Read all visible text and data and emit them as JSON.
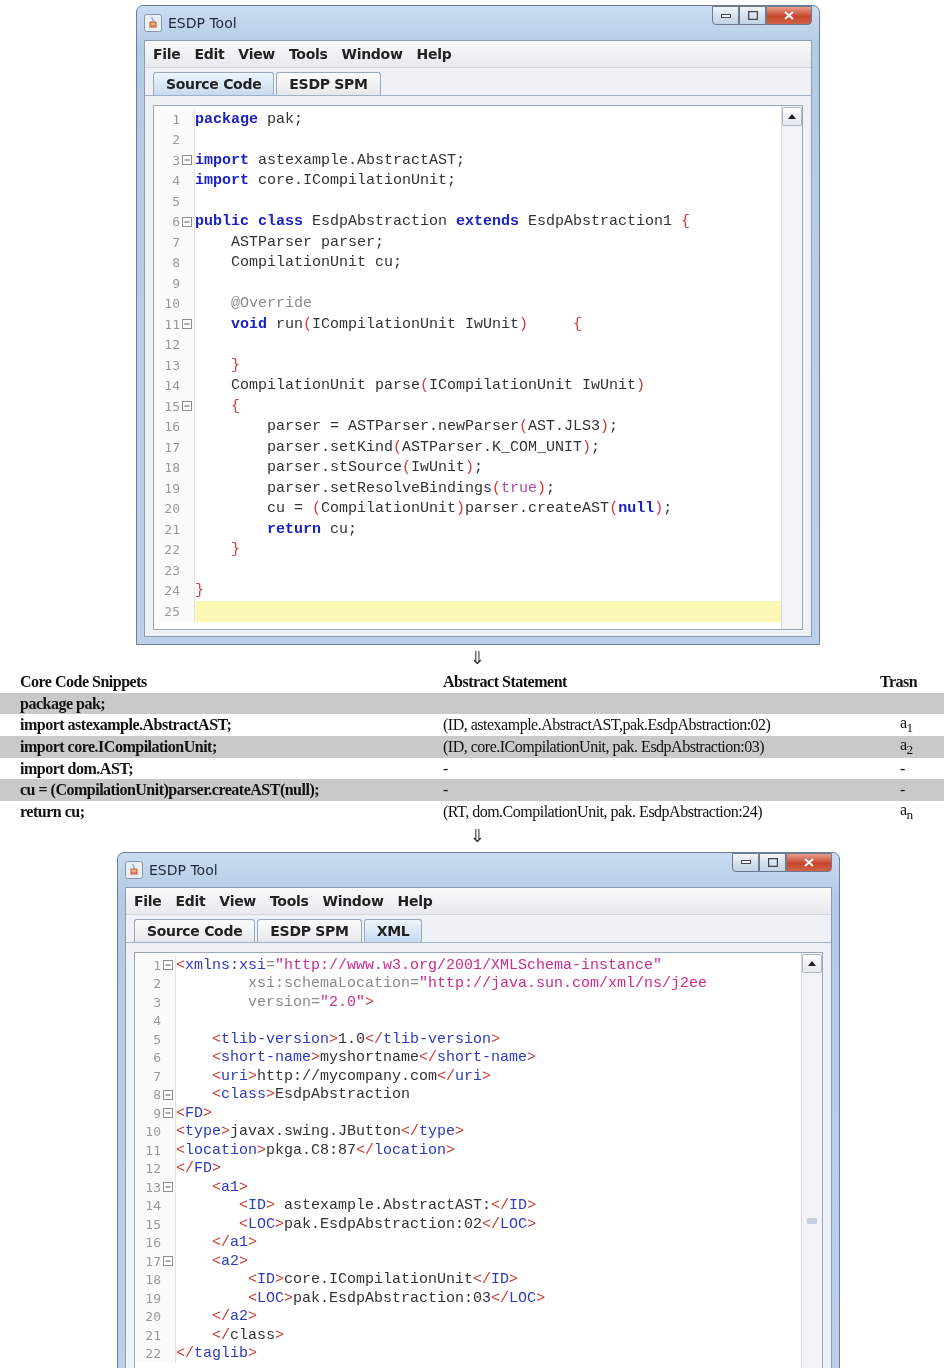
{
  "windows": [
    {
      "title": "ESDP Tool",
      "menu": [
        "File",
        "Edit",
        "View",
        "Tools",
        "Window",
        "Help"
      ],
      "tabs": [
        {
          "label": "Source Code",
          "selected": true
        },
        {
          "label": "ESDP SPM",
          "selected": false
        }
      ],
      "lines": [
        {
          "number": "1",
          "fold": false,
          "highlighted": false,
          "tokens": [
            {
              "kind": "kw",
              "text": "package"
            },
            {
              "kind": "id",
              "text": " pak;"
            }
          ]
        },
        {
          "number": "2",
          "fold": false,
          "highlighted": false
        },
        {
          "number": "3",
          "fold": true,
          "highlighted": false,
          "tokens": [
            {
              "kind": "kw",
              "text": "import"
            },
            {
              "kind": "id",
              "text": " astexample.AbstractAST;"
            }
          ]
        },
        {
          "number": "4",
          "fold": false,
          "highlighted": false,
          "tokens": [
            {
              "kind": "kw",
              "text": "import"
            },
            {
              "kind": "id",
              "text": " core.ICompilationUnit;"
            }
          ]
        },
        {
          "number": "5",
          "fold": false,
          "highlighted": false
        },
        {
          "number": "6",
          "fold": true,
          "highlighted": false,
          "tokens": [
            {
              "kind": "kw",
              "text": "public class"
            },
            {
              "kind": "id",
              "text": " EsdpAbstraction "
            },
            {
              "kind": "kw",
              "text": "extends"
            },
            {
              "kind": "id",
              "text": " EsdpAbstraction1 "
            },
            {
              "kind": "br",
              "text": "{"
            }
          ]
        },
        {
          "number": "7",
          "fold": false,
          "highlighted": false,
          "tokens": [
            {
              "kind": "id",
              "text": "    ASTParser parser;"
            }
          ]
        },
        {
          "number": "8",
          "fold": false,
          "highlighted": false,
          "tokens": [
            {
              "kind": "id",
              "text": "    CompilationUnit cu;"
            }
          ]
        },
        {
          "number": "9",
          "fold": false,
          "highlighted": false
        },
        {
          "number": "10",
          "fold": false,
          "highlighted": false,
          "tokens": [
            {
              "kind": "ann",
              "text": "    @Override"
            }
          ]
        },
        {
          "number": "11",
          "fold": true,
          "highlighted": false,
          "tokens": [
            {
              "kind": "kw",
              "text": "    void"
            },
            {
              "kind": "id",
              "text": " run"
            },
            {
              "kind": "br",
              "text": "("
            },
            {
              "kind": "id",
              "text": "ICompilationUnit IwUnit"
            },
            {
              "kind": "br",
              "text": ")"
            },
            {
              "kind": "br",
              "text": "     {"
            }
          ]
        },
        {
          "number": "12",
          "fold": false,
          "highlighted": false
        },
        {
          "number": "13",
          "fold": false,
          "highlighted": false,
          "tokens": [
            {
              "kind": "br",
              "text": "    }"
            }
          ]
        },
        {
          "number": "14",
          "fold": false,
          "highlighted": false,
          "tokens": [
            {
              "kind": "id",
              "text": "    CompilationUnit parse"
            },
            {
              "kind": "br",
              "text": "("
            },
            {
              "kind": "id",
              "text": "ICompilationUnit IwUnit"
            },
            {
              "kind": "br",
              "text": ")"
            }
          ]
        },
        {
          "number": "15",
          "fold": true,
          "highlighted": false,
          "tokens": [
            {
              "kind": "br",
              "text": "    {"
            }
          ]
        },
        {
          "number": "16",
          "fold": false,
          "highlighted": false,
          "tokens": [
            {
              "kind": "id",
              "text": "        parser = ASTParser.newParser"
            },
            {
              "kind": "br",
              "text": "("
            },
            {
              "kind": "id",
              "text": "AST.JLS3"
            },
            {
              "kind": "br",
              "text": ")"
            },
            {
              "kind": "id",
              "text": ";"
            }
          ]
        },
        {
          "number": "17",
          "fold": false,
          "highlighted": false,
          "tokens": [
            {
              "kind": "id",
              "text": "        parser.setKind"
            },
            {
              "kind": "br",
              "text": "("
            },
            {
              "kind": "id",
              "text": "ASTParser.K_COM_UNIT"
            },
            {
              "kind": "br",
              "text": ")"
            },
            {
              "kind": "id",
              "text": ";"
            }
          ]
        },
        {
          "number": "18",
          "fold": false,
          "highlighted": false,
          "tokens": [
            {
              "kind": "id",
              "text": "        parser.stSource"
            },
            {
              "kind": "br",
              "text": "("
            },
            {
              "kind": "id",
              "text": "IwUnit"
            },
            {
              "kind": "br",
              "text": ")"
            },
            {
              "kind": "id",
              "text": ";"
            }
          ]
        },
        {
          "number": "19",
          "fold": false,
          "highlighted": false,
          "tokens": [
            {
              "kind": "id",
              "text": "        parser.setResolveBindings"
            },
            {
              "kind": "br",
              "text": "("
            },
            {
              "kind": "lit",
              "text": "true"
            },
            {
              "kind": "br",
              "text": ")"
            },
            {
              "kind": "id",
              "text": ";"
            }
          ]
        },
        {
          "number": "20",
          "fold": false,
          "highlighted": false,
          "tokens": [
            {
              "kind": "id",
              "text": "        cu = "
            },
            {
              "kind": "br",
              "text": "("
            },
            {
              "kind": "id",
              "text": "CompilationUnit"
            },
            {
              "kind": "br",
              "text": ")"
            },
            {
              "kind": "id",
              "text": "parser.createAST"
            },
            {
              "kind": "br",
              "text": "("
            },
            {
              "kind": "kw",
              "text": "null"
            },
            {
              "kind": "br",
              "text": ")"
            },
            {
              "kind": "id",
              "text": ";"
            }
          ]
        },
        {
          "number": "21",
          "fold": false,
          "highlighted": false,
          "tokens": [
            {
              "kind": "kw",
              "text": "        return"
            },
            {
              "kind": "id",
              "text": " cu;"
            }
          ]
        },
        {
          "number": "22",
          "fold": false,
          "highlighted": false,
          "tokens": [
            {
              "kind": "br",
              "text": "    }"
            }
          ]
        },
        {
          "number": "23",
          "fold": false,
          "highlighted": false
        },
        {
          "number": "24",
          "fold": false,
          "highlighted": false,
          "tokens": [
            {
              "kind": "br",
              "text": "}"
            }
          ]
        },
        {
          "number": "25",
          "fold": false,
          "highlighted": true
        }
      ]
    },
    {
      "title": "ESDP Tool",
      "menu": [
        "File",
        "Edit",
        "View",
        "Tools",
        "Window",
        "Help"
      ],
      "tabs": [
        {
          "label": "Source Code",
          "selected": false
        },
        {
          "label": "ESDP SPM",
          "selected": false
        },
        {
          "label": "XML",
          "selected": true
        }
      ],
      "lines": [
        {
          "number": "1",
          "fold": true,
          "highlighted": false,
          "tokens": [
            {
              "kind": "tag",
              "text": "<"
            },
            {
              "kind": "tname",
              "text": "xmlns:xsi"
            },
            {
              "kind": "attr",
              "text": "="
            },
            {
              "kind": "str",
              "text": "\"http://www.w3.org/2001/XMLSchema-instance\""
            }
          ]
        },
        {
          "number": "2",
          "fold": false,
          "highlighted": false,
          "tokens": [
            {
              "kind": "attr",
              "text": "        xsi:schemaLocation="
            },
            {
              "kind": "str",
              "text": "\"http://java.sun.com/xml/ns/j2ee"
            }
          ]
        },
        {
          "number": "3",
          "fold": false,
          "highlighted": false,
          "tokens": [
            {
              "kind": "attr",
              "text": "        version="
            },
            {
              "kind": "str",
              "text": "\"2.0\""
            },
            {
              "kind": "tag",
              "text": ">"
            }
          ]
        },
        {
          "number": "4",
          "fold": false,
          "highlighted": false
        },
        {
          "number": "5",
          "fold": false,
          "highlighted": false,
          "tokens": [
            {
              "kind": "tag",
              "text": "    <"
            },
            {
              "kind": "tname",
              "text": "tlib-version"
            },
            {
              "kind": "tag",
              "text": ">"
            },
            {
              "kind": "id",
              "text": "1.0"
            },
            {
              "kind": "tag",
              "text": "</"
            },
            {
              "kind": "tname",
              "text": "tlib-version"
            },
            {
              "kind": "tag",
              "text": ">"
            }
          ]
        },
        {
          "number": "6",
          "fold": false,
          "highlighted": false,
          "tokens": [
            {
              "kind": "tag",
              "text": "    <"
            },
            {
              "kind": "tname",
              "text": "short-name"
            },
            {
              "kind": "tag",
              "text": ">"
            },
            {
              "kind": "id",
              "text": "myshortname"
            },
            {
              "kind": "tag",
              "text": "</"
            },
            {
              "kind": "tname",
              "text": "short-name"
            },
            {
              "kind": "tag",
              "text": ">"
            }
          ]
        },
        {
          "number": "7",
          "fold": false,
          "highlighted": false,
          "tokens": [
            {
              "kind": "tag",
              "text": "    <"
            },
            {
              "kind": "tname",
              "text": "uri"
            },
            {
              "kind": "tag",
              "text": ">"
            },
            {
              "kind": "id",
              "text": "http://mycompany.com"
            },
            {
              "kind": "tag",
              "text": "</"
            },
            {
              "kind": "tname",
              "text": "uri"
            },
            {
              "kind": "tag",
              "text": ">"
            }
          ]
        },
        {
          "number": "8",
          "fold": true,
          "highlighted": false,
          "tokens": [
            {
              "kind": "tag",
              "text": "    <"
            },
            {
              "kind": "tname",
              "text": "class"
            },
            {
              "kind": "tag",
              "text": ">"
            },
            {
              "kind": "id",
              "text": "EsdpAbstraction"
            }
          ]
        },
        {
          "number": "9",
          "fold": true,
          "highlighted": false,
          "tokens": [
            {
              "kind": "tag",
              "text": "<"
            },
            {
              "kind": "tname",
              "text": "FD"
            },
            {
              "kind": "tag",
              "text": ">"
            }
          ]
        },
        {
          "number": "10",
          "fold": false,
          "highlighted": false,
          "tokens": [
            {
              "kind": "tag",
              "text": "<"
            },
            {
              "kind": "tname",
              "text": "type"
            },
            {
              "kind": "tag",
              "text": ">"
            },
            {
              "kind": "id",
              "text": "javax.swing.JButton"
            },
            {
              "kind": "tag",
              "text": "</"
            },
            {
              "kind": "tname",
              "text": "type"
            },
            {
              "kind": "tag",
              "text": ">"
            }
          ]
        },
        {
          "number": "11",
          "fold": false,
          "highlighted": false,
          "tokens": [
            {
              "kind": "tag",
              "text": "<"
            },
            {
              "kind": "tname",
              "text": "location"
            },
            {
              "kind": "tag",
              "text": ">"
            },
            {
              "kind": "id",
              "text": "pkga.C8:87"
            },
            {
              "kind": "tag",
              "text": "</"
            },
            {
              "kind": "tname",
              "text": "location"
            },
            {
              "kind": "tag",
              "text": ">"
            }
          ]
        },
        {
          "number": "12",
          "fold": false,
          "highlighted": false,
          "tokens": [
            {
              "kind": "tag",
              "text": "</"
            },
            {
              "kind": "tname",
              "text": "FD"
            },
            {
              "kind": "tag",
              "text": ">"
            }
          ]
        },
        {
          "number": "13",
          "fold": true,
          "highlighted": false,
          "tokens": [
            {
              "kind": "tag",
              "text": "    <"
            },
            {
              "kind": "tname",
              "text": "a1"
            },
            {
              "kind": "tag",
              "text": ">"
            }
          ]
        },
        {
          "number": "14",
          "fold": false,
          "highlighted": false,
          "tokens": [
            {
              "kind": "tag",
              "text": "       <"
            },
            {
              "kind": "tname",
              "text": "ID"
            },
            {
              "kind": "tag",
              "text": ">"
            },
            {
              "kind": "id",
              "text": " astexample.AbstractAST:"
            },
            {
              "kind": "tag",
              "text": "</"
            },
            {
              "kind": "tname",
              "text": "ID"
            },
            {
              "kind": "tag",
              "text": ">"
            }
          ]
        },
        {
          "number": "15",
          "fold": false,
          "highlighted": false,
          "tokens": [
            {
              "kind": "tag",
              "text": "       <"
            },
            {
              "kind": "tname",
              "text": "LOC"
            },
            {
              "kind": "tag",
              "text": ">"
            },
            {
              "kind": "id",
              "text": "pak.EsdpAbstraction:02"
            },
            {
              "kind": "tag",
              "text": "</"
            },
            {
              "kind": "tname",
              "text": "LOC"
            },
            {
              "kind": "tag",
              "text": ">"
            }
          ]
        },
        {
          "number": "16",
          "fold": false,
          "highlighted": false,
          "tokens": [
            {
              "kind": "tag",
              "text": "    </"
            },
            {
              "kind": "tname",
              "text": "a1"
            },
            {
              "kind": "tag",
              "text": ">"
            }
          ]
        },
        {
          "number": "17",
          "fold": true,
          "highlighted": false,
          "tokens": [
            {
              "kind": "tag",
              "text": "    <"
            },
            {
              "kind": "tname",
              "text": "a2"
            },
            {
              "kind": "tag",
              "text": ">"
            }
          ]
        },
        {
          "number": "18",
          "fold": false,
          "highlighted": false,
          "tokens": [
            {
              "kind": "tag",
              "text": "        <"
            },
            {
              "kind": "tname",
              "text": "ID"
            },
            {
              "kind": "tag",
              "text": ">"
            },
            {
              "kind": "id",
              "text": "core.ICompilationUnit"
            },
            {
              "kind": "tag",
              "text": "</"
            },
            {
              "kind": "tname",
              "text": "ID"
            },
            {
              "kind": "tag",
              "text": ">"
            }
          ]
        },
        {
          "number": "19",
          "fold": false,
          "highlighted": false,
          "tokens": [
            {
              "kind": "tag",
              "text": "        <"
            },
            {
              "kind": "tname",
              "text": "LOC"
            },
            {
              "kind": "tag",
              "text": ">"
            },
            {
              "kind": "id",
              "text": "pak.EsdpAbstraction:03"
            },
            {
              "kind": "tag",
              "text": "</"
            },
            {
              "kind": "tname",
              "text": "LOC"
            },
            {
              "kind": "tag",
              "text": ">"
            }
          ]
        },
        {
          "number": "20",
          "fold": false,
          "highlighted": false,
          "tokens": [
            {
              "kind": "tag",
              "text": "    </"
            },
            {
              "kind": "tname",
              "text": "a2"
            },
            {
              "kind": "tag",
              "text": ">"
            }
          ]
        },
        {
          "number": "21",
          "fold": false,
          "highlighted": false,
          "tokens": [
            {
              "kind": "tag",
              "text": "    </"
            },
            {
              "kind": "id",
              "text": "class"
            },
            {
              "kind": "tag",
              "text": ">"
            }
          ]
        },
        {
          "number": "22",
          "fold": false,
          "highlighted": false,
          "tokens": [
            {
              "kind": "tag",
              "text": "</"
            },
            {
              "kind": "tname",
              "text": "taglib"
            },
            {
              "kind": "tag",
              "text": ">"
            }
          ]
        }
      ]
    }
  ],
  "arrows": [
    "⇓",
    "⇓"
  ],
  "table": {
    "columns": [
      "Core Code Snippets",
      "Abstract Statement",
      "Trasn"
    ],
    "rows": [
      [
        "package pak;",
        "",
        ""
      ],
      [
        "import astexample.AbstractAST;",
        "(ID, astexample.AbstractAST,pak.EsdpAbstraction:02)",
        "a$_{1}$"
      ],
      [
        "import core.ICompilationUnit;",
        "(ID, core.ICompilationUnit, pak. EsdpAbstraction:03)",
        "a$_{2}$"
      ],
      [
        "import dom.AST;",
        "-",
        "-"
      ],
      [
        "cu = (CompilationUnit)parser.createAST(null);",
        "-",
        "-"
      ],
      [
        "return cu;",
        "(RT, dom.CompilationUnit, pak. EsdpAbstraction:24)",
        "a$_{n}$"
      ]
    ]
  }
}
